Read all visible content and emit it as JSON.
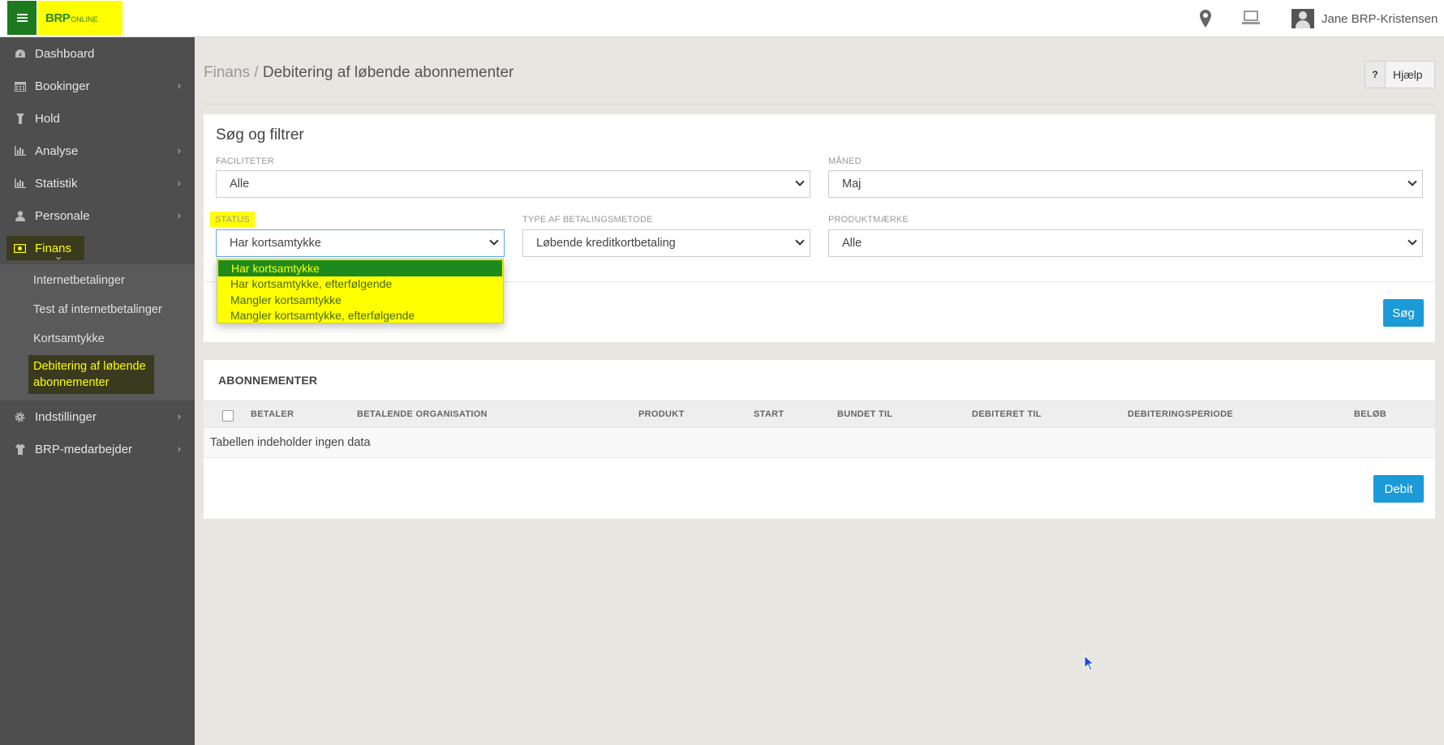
{
  "topbar": {
    "logo_main": "BRP",
    "logo_sub": "ONLINE",
    "user_name": "Jane BRP-Kristensen"
  },
  "sidebar": {
    "items": [
      {
        "label": "Dashboard",
        "icon": "dashboard-icon"
      },
      {
        "label": "Bookinger",
        "icon": "calendar-icon"
      },
      {
        "label": "Hold",
        "icon": "hold-icon"
      },
      {
        "label": "Analyse",
        "icon": "bar-chart-icon"
      },
      {
        "label": "Statistik",
        "icon": "bar-chart-icon"
      },
      {
        "label": "Personale",
        "icon": "person-icon"
      },
      {
        "label": "Finans",
        "icon": "money-icon"
      },
      {
        "label": "Indstillinger",
        "icon": "gear-icon"
      },
      {
        "label": "BRP-medarbejder",
        "icon": "shirt-icon"
      }
    ],
    "finans_sub": [
      "Internetbetalinger",
      "Test af internetbetalinger",
      "Kortsamtykke",
      "Debitering af løbende abonnementer"
    ]
  },
  "breadcrumb": {
    "parent": "Finans",
    "separator": " / ",
    "current": "Debitering af løbende abonnementer"
  },
  "help_label": "Hjælp",
  "help_q": "?",
  "filter": {
    "title": "Søg og filtrer",
    "faciliteter_label": "FACILITETER",
    "faciliteter_value": "Alle",
    "maaned_label": "MÅNED",
    "maaned_value": "Maj",
    "status_label": "STATUS",
    "status_value": "Har kortsamtykke",
    "betaling_label": "TYPE AF BETALINGSMETODE",
    "betaling_value": "Løbende kreditkortbetaling",
    "produkt_label": "PRODUKTMÆRKE",
    "produkt_value": "Alle",
    "search_button": "Søg",
    "status_options": [
      "Har kortsamtykke",
      "Har kortsamtykke, efterfølgende",
      "Mangler kortsamtykke",
      "Mangler kortsamtykke, efterfølgende"
    ]
  },
  "table": {
    "title": "ABONNEMENTER",
    "columns": [
      "BETALER",
      "BETALENDE ORGANISATION",
      "PRODUKT",
      "START",
      "BUNDET TIL",
      "DEBITERET TIL",
      "DEBITERINGSPERIODE",
      "BELØB"
    ],
    "empty_text": "Tabellen indeholder ingen data",
    "debit_button": "Debit"
  },
  "colors": {
    "brand_green": "#1e7a1e",
    "highlight_yellow": "#ffff00",
    "primary_blue": "#1a9ad6",
    "sidebar_bg": "#4e4e4e"
  }
}
